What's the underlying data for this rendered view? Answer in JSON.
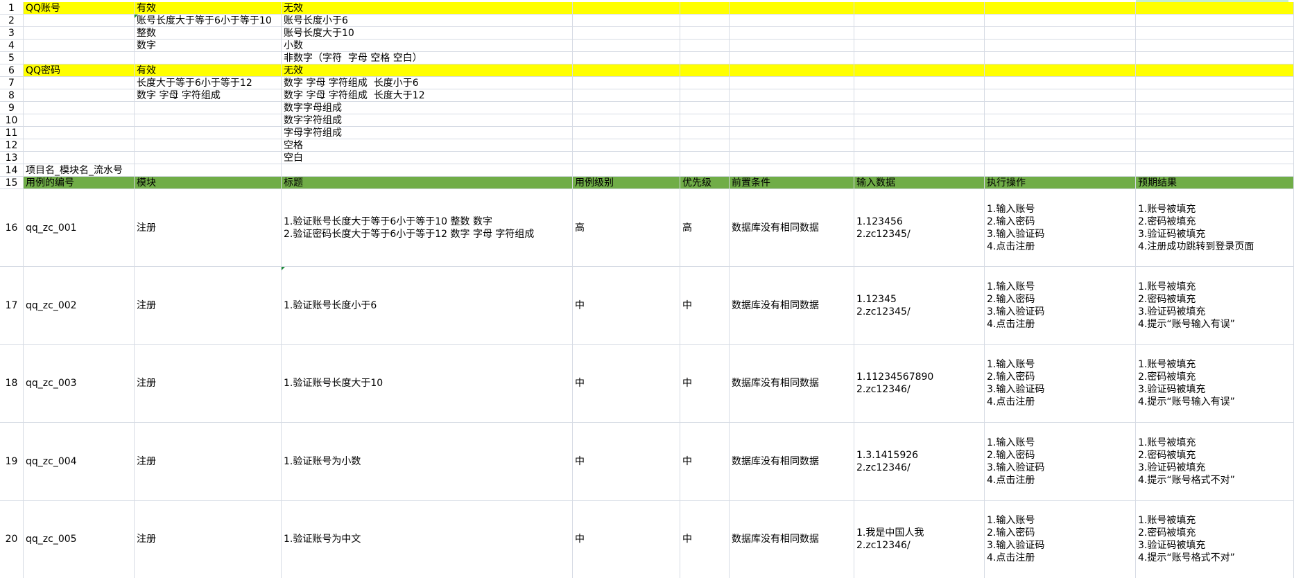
{
  "colors": {
    "section_fill": "#ffff00",
    "header_fill": "#70ad47",
    "grid_line": "#d6dbe4"
  },
  "rows": [
    {
      "n": "1",
      "fill": "yellow",
      "cells": [
        "QQ账号",
        "有效",
        "无效",
        "",
        "",
        "",
        "",
        "",
        ""
      ]
    },
    {
      "n": "2",
      "cells": [
        "",
        "账号长度大于等于6小于等于10",
        "账号长度小于6",
        "",
        "",
        "",
        "",
        "",
        ""
      ]
    },
    {
      "n": "3",
      "cells": [
        "",
        "整数",
        "账号长度大于10",
        "",
        "",
        "",
        "",
        "",
        ""
      ]
    },
    {
      "n": "4",
      "cells": [
        "",
        "数字",
        "小数",
        "",
        "",
        "",
        "",
        "",
        ""
      ]
    },
    {
      "n": "5",
      "cells": [
        "",
        "",
        "非数字（字符  字母 空格 空白）",
        "",
        "",
        "",
        "",
        "",
        ""
      ]
    },
    {
      "n": "6",
      "fill": "yellow",
      "cells": [
        "QQ密码",
        "有效",
        "无效",
        "",
        "",
        "",
        "",
        "",
        ""
      ]
    },
    {
      "n": "7",
      "cells": [
        "",
        "长度大于等于6小于等于12",
        "数字 字母 字符组成  长度小于6",
        "",
        "",
        "",
        "",
        "",
        ""
      ]
    },
    {
      "n": "8",
      "cells": [
        "",
        "数字 字母 字符组成",
        "数字 字母 字符组成  长度大于12",
        "",
        "",
        "",
        "",
        "",
        ""
      ]
    },
    {
      "n": "9",
      "cells": [
        "",
        "",
        "数字字母组成",
        "",
        "",
        "",
        "",
        "",
        ""
      ]
    },
    {
      "n": "10",
      "cells": [
        "",
        "",
        "数字字符组成",
        "",
        "",
        "",
        "",
        "",
        ""
      ]
    },
    {
      "n": "11",
      "cells": [
        "",
        "",
        "字母字符组成",
        "",
        "",
        "",
        "",
        "",
        ""
      ]
    },
    {
      "n": "12",
      "cells": [
        "",
        "",
        "空格",
        "",
        "",
        "",
        "",
        "",
        ""
      ]
    },
    {
      "n": "13",
      "cells": [
        "",
        "",
        "空白",
        "",
        "",
        "",
        "",
        "",
        ""
      ]
    },
    {
      "n": "14",
      "cells": [
        "项目名_模块名_流水号",
        "",
        "",
        "",
        "",
        "",
        "",
        "",
        ""
      ]
    },
    {
      "n": "15",
      "fill": "green",
      "cells": [
        "用例的编号",
        "模块",
        "标题",
        "用例级别",
        "优先级",
        "前置条件",
        "输入数据",
        "执行操作",
        "预期结果"
      ]
    },
    {
      "n": "16",
      "tall": true,
      "cells": [
        "qq_zc_001",
        "注册",
        "1.验证账号长度大于等于6小于等于10 整数 数字\n2.验证密码长度大于等于6小于等于12 数字 字母 字符组成",
        "高",
        "高",
        "数据库没有相同数据",
        "1.123456\n2.zc12345/",
        "1.输入账号\n2.输入密码\n3.输入验证码\n4.点击注册",
        "1.账号被填充\n2.密码被填充\n3.验证码被填充\n4.注册成功跳转到登录页面"
      ]
    },
    {
      "n": "17",
      "tall": true,
      "cells": [
        "qq_zc_002",
        "注册",
        "1.验证账号长度小于6",
        "中",
        "中",
        "数据库没有相同数据",
        "1.12345\n2.zc12345/",
        "1.输入账号\n2.输入密码\n3.输入验证码\n4.点击注册",
        "1.账号被填充\n2.密码被填充\n3.验证码被填充\n4.提示“账号输入有误”"
      ]
    },
    {
      "n": "18",
      "tall": true,
      "cells": [
        "qq_zc_003",
        "注册",
        "1.验证账号长度大于10",
        "中",
        "中",
        "数据库没有相同数据",
        "1.11234567890\n2.zc12346/",
        "1.输入账号\n2.输入密码\n3.输入验证码\n4.点击注册",
        "1.账号被填充\n2.密码被填充\n3.验证码被填充\n4.提示“账号输入有误”"
      ]
    },
    {
      "n": "19",
      "tall": true,
      "cells": [
        "qq_zc_004",
        "注册",
        "1.验证账号为小数",
        "中",
        "中",
        "数据库没有相同数据",
        "1.3.1415926\n2.zc12346/",
        "1.输入账号\n2.输入密码\n3.输入验证码\n4.点击注册",
        "1.账号被填充\n2.密码被填充\n3.验证码被填充\n4.提示“账号格式不对”"
      ]
    },
    {
      "n": "20",
      "tall": true,
      "cells": [
        "qq_zc_005",
        "注册",
        "1.验证账号为中文",
        "中",
        "中",
        "数据库没有相同数据",
        "1.我是中国人我\n2.zc12346/",
        "1.输入账号\n2.输入密码\n3.输入验证码\n4.点击注册",
        "1.账号被填充\n2.密码被填充\n3.验证码被填充\n4.提示“账号格式不对”"
      ]
    }
  ]
}
